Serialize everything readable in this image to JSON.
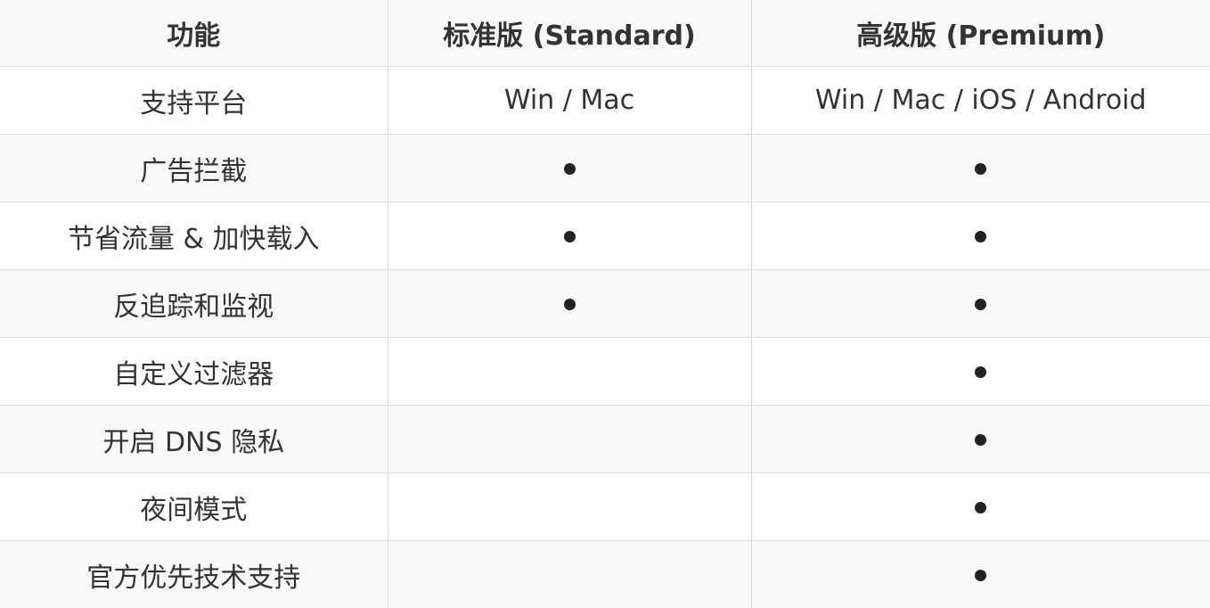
{
  "table": {
    "headers": [
      "功能",
      "标准版 (Standard)",
      "高级版 (Premium)"
    ],
    "rows": [
      {
        "feature": "支持平台",
        "standard": "Win / Mac",
        "premium": "Win / Mac / iOS / Android"
      },
      {
        "feature": "广告拦截",
        "standard": "●",
        "premium": "●"
      },
      {
        "feature": "节省流量 & 加快载入",
        "standard": "●",
        "premium": "●"
      },
      {
        "feature": "反追踪和监视",
        "standard": "●",
        "premium": "●"
      },
      {
        "feature": "自定义过滤器",
        "standard": "",
        "premium": "●"
      },
      {
        "feature": "开启 DNS 隐私",
        "standard": "",
        "premium": "●"
      },
      {
        "feature": "夜间模式",
        "standard": "",
        "premium": "●"
      },
      {
        "feature": "官方优先技术支持",
        "standard": "",
        "premium": "●"
      }
    ]
  },
  "colors": {
    "header_bg": "#f8f8f8",
    "alt_row_bg": "#f8f8f8",
    "border": "#dddddd",
    "text": "#333333",
    "dot": "#222222"
  }
}
